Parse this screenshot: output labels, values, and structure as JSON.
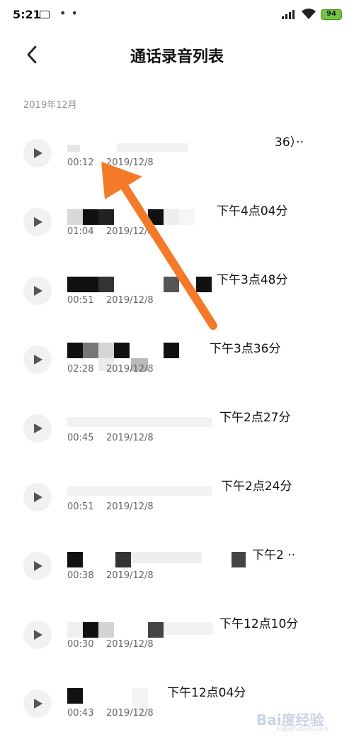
{
  "status_bar": {
    "time": "5:21",
    "dots": "• •",
    "battery": "94"
  },
  "header": {
    "title": "通话录音列表",
    "back_icon": "chevron-left-icon"
  },
  "section": {
    "label": "2019年12月"
  },
  "recordings": [
    {
      "title": "36）··",
      "duration": "00:12",
      "date": "2019/12/8"
    },
    {
      "title": "下午4点04分",
      "duration": "01:04",
      "date": "2019/12/8"
    },
    {
      "title": "下午3点48分",
      "duration": "00:51",
      "date": "2019/12/8"
    },
    {
      "title": "下午3点36分",
      "duration": "02:28",
      "date": "2019/12/8"
    },
    {
      "title": "下午2点27分",
      "duration": "00:45",
      "date": "2019/12/8"
    },
    {
      "title": "下午2点24分",
      "duration": "00:51",
      "date": "2019/12/8"
    },
    {
      "title": "下午2 ··",
      "duration": "00:38",
      "date": "2019/12/8"
    },
    {
      "title": "下午12点10分",
      "duration": "00:30",
      "date": "2019/12/8"
    },
    {
      "title": "下午12点04分",
      "duration": "00:43",
      "date": "2019/12/8"
    }
  ],
  "watermark": {
    "main": "Bai度经验",
    "sub": "jingyan.baidu.com"
  },
  "colors": {
    "annotation_arrow": "#f47a2a",
    "play_bg": "#f1f1f1",
    "battery": "#74c642"
  }
}
